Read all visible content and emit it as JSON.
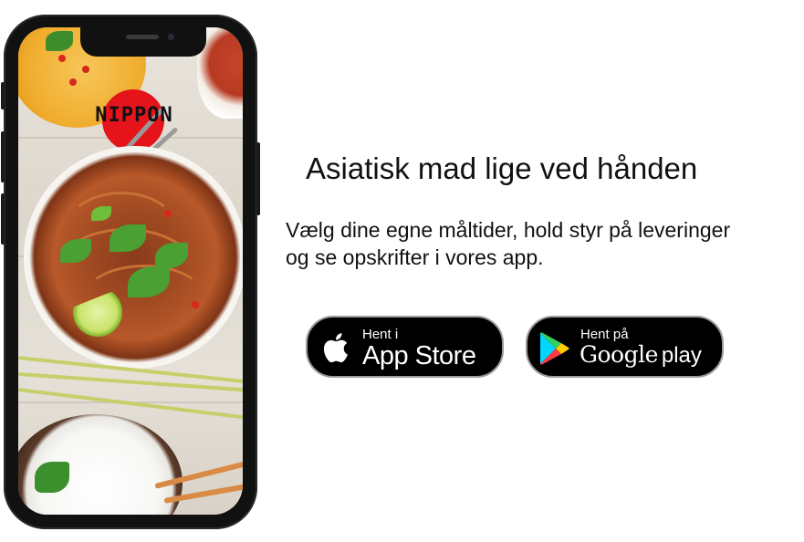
{
  "app": {
    "logo_text": "NIPPON",
    "brand_color": "#e5141b"
  },
  "promo": {
    "headline": "Asiatisk mad lige ved hånden",
    "description_line1": "Vælg dine egne måltider, hold styr på leveringer",
    "description_line2": "og se opskrifter i vores app."
  },
  "stores": {
    "appstore": {
      "small_label": "Hent i",
      "big_label": "App Store",
      "icon": "apple-icon"
    },
    "googleplay": {
      "small_label": "Hent på",
      "big_label_google": "Google",
      "big_label_play": "play",
      "icon": "google-play-icon"
    }
  }
}
